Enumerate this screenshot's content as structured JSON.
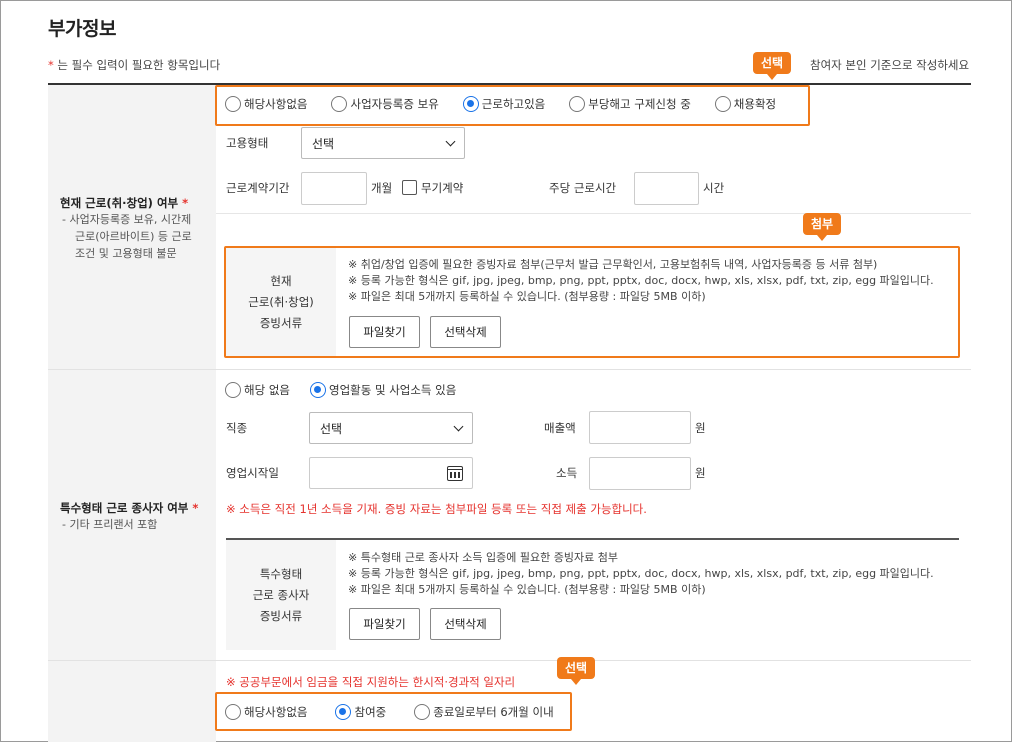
{
  "page": {
    "title": "부가정보",
    "required_note_star": "*",
    "required_note": " 는 필수 입력이 필요한 항목입니다",
    "right_note": "참여자 본인 기준으로 작성하세요"
  },
  "badges": {
    "select_top": "선택",
    "attach": "첨부",
    "select_bottom": "선택"
  },
  "section1": {
    "label": "현재 근로(취·창업) 여부",
    "required": "*",
    "sub_lines": [
      "- 사업자등록증 보유, 시간제",
      "근로(아르바이트) 등 근로",
      "조건 및 고용형태 불문"
    ],
    "radios": [
      {
        "label": "해당사항없음",
        "checked": false
      },
      {
        "label": "사업자등록증 보유",
        "checked": false
      },
      {
        "label": "근로하고있음",
        "checked": true
      },
      {
        "label": "부당해고 구제신청 중",
        "checked": false
      },
      {
        "label": "채용확정",
        "checked": false
      }
    ],
    "employment_type_label": "고용형태",
    "employment_type_value": "선택",
    "contract_period_label": "근로계약기간",
    "contract_unit": "개월",
    "indefinite_label": "무기계약",
    "weekly_hours_label": "주당 근로시간",
    "hours_unit": "시간",
    "attach": {
      "label_lines": [
        "현재",
        "근로(취·창업)",
        "증빙서류"
      ],
      "notes": [
        "※ 취업/창업 입증에 필요한 증빙자료 첨부(근무처 발급 근무확인서, 고용보험취득 내역, 사업자등록증 등 서류 첨부)",
        "※ 등록 가능한 형식은 gif, jpg, jpeg, bmp, png, ppt, pptx, doc, docx, hwp, xls, xlsx, pdf, txt, zip, egg 파일입니다.",
        "※ 파일은 최대 5개까지 등록하실 수 있습니다. (첨부용량 : 파일당 5MB 이하)"
      ],
      "find_button": "파일찾기",
      "delete_button": "선택삭제"
    }
  },
  "section2": {
    "label": "특수형태 근로 종사자 여부",
    "required": "*",
    "sub": "- 기타 프리랜서 포함",
    "radios": [
      {
        "label": "해당 없음",
        "checked": false
      },
      {
        "label": "영업활동 및 사업소득 있음",
        "checked": true
      }
    ],
    "job_label": "직종",
    "job_value": "선택",
    "sales_label": "매출액",
    "sales_unit": "원",
    "start_date_label": "영업시작일",
    "income_label": "소득",
    "income_unit": "원",
    "warning": "※ 소득은 직전 1년 소득을 기재. 증빙 자료는 첨부파일 등록 또는 직접 제출 가능합니다.",
    "attach": {
      "label_lines": [
        "특수형태",
        "근로 종사자",
        "증빙서류"
      ],
      "notes": [
        "※ 특수형태 근로 종사자 소득 입증에 필요한 증빙자료 첨부",
        "※ 등록 가능한 형식은 gif, jpg, jpeg, bmp, png, ppt, pptx, doc, docx, hwp, xls, xlsx, pdf, txt, zip, egg 파일입니다.",
        "※ 파일은 최대 5개까지 등록하실 수 있습니다. (첨부용량 : 파일당 5MB 이하)"
      ],
      "find_button": "파일찾기",
      "delete_button": "선택삭제"
    }
  },
  "section3": {
    "warning": "※ 공공부문에서 임금을 직접 지원하는 한시적·경과적 일자리",
    "radios": [
      {
        "label": "해당사항없음",
        "checked": false
      },
      {
        "label": "참여중",
        "checked": true
      },
      {
        "label": "종료일로부터 6개월 이내",
        "checked": false
      }
    ]
  },
  "colors": {
    "accent": "#f07a1a",
    "radio_on": "#1a73e8",
    "required": "#e5322d"
  }
}
